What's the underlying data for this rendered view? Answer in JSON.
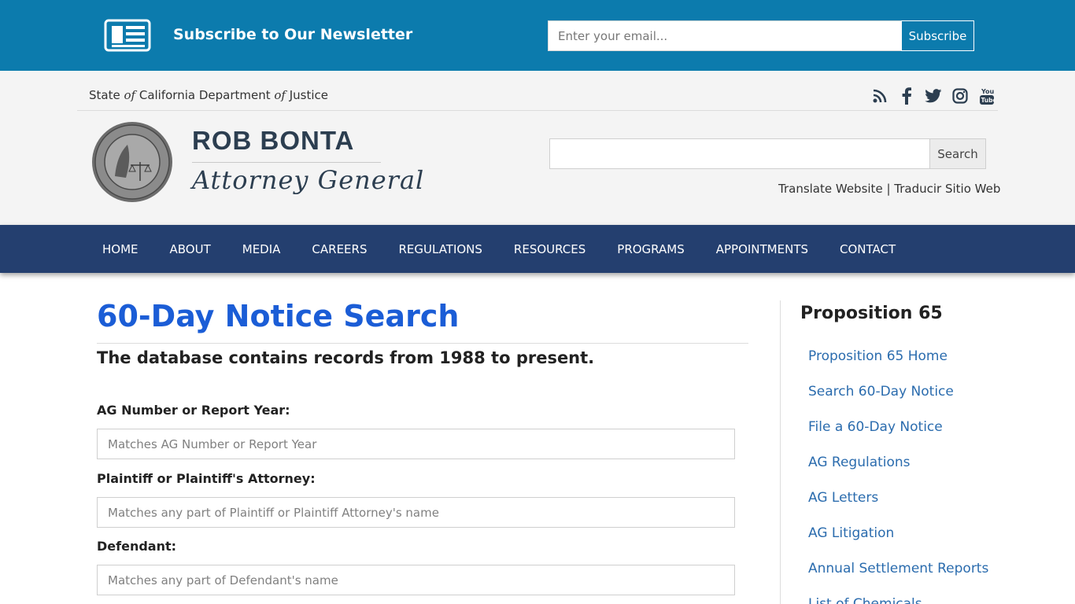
{
  "newsletter": {
    "title": "Subscribe to Our Newsletter",
    "email_placeholder": "Enter your email...",
    "subscribe_label": "Subscribe"
  },
  "header": {
    "state_prefix": "State ",
    "state_of1": "of",
    "state_middle": " California Department ",
    "state_of2": "of",
    "state_suffix": " Justice",
    "ag_name": "ROB BONTA",
    "ag_title": "Attorney General",
    "search_label": "Search",
    "translate_en": "Translate Website",
    "translate_sep": " | ",
    "translate_es": "Traducir Sitio Web",
    "social_icons": [
      "rss-icon",
      "facebook-icon",
      "twitter-icon",
      "instagram-icon",
      "youtube-icon"
    ]
  },
  "nav": {
    "items": [
      "HOME",
      "ABOUT",
      "MEDIA",
      "CAREERS",
      "REGULATIONS",
      "RESOURCES",
      "PROGRAMS",
      "APPOINTMENTS",
      "CONTACT"
    ]
  },
  "main": {
    "title": "60-Day Notice Search",
    "subtitle": "The database contains records from 1988 to present.",
    "fields": [
      {
        "label": "AG Number or Report Year:",
        "placeholder": "Matches AG Number or Report Year"
      },
      {
        "label": "Plaintiff or Plaintiff's Attorney:",
        "placeholder": "Matches any part of Plaintiff or Plaintiff Attorney's name"
      },
      {
        "label": "Defendant:",
        "placeholder": "Matches any part of Defendant's name"
      }
    ]
  },
  "sidebar": {
    "title": "Proposition 65",
    "links": [
      "Proposition 65 Home",
      "Search 60-Day Notice",
      "File a 60-Day Notice",
      "AG Regulations",
      "AG Letters",
      "AG Litigation",
      "Annual Settlement Reports",
      "List of Chemicals"
    ]
  },
  "colors": {
    "newsletter_bg": "#0c7bad",
    "nav_bg": "#243f6f",
    "title_blue": "#1b5dd6",
    "link_blue": "#2b6cae"
  }
}
